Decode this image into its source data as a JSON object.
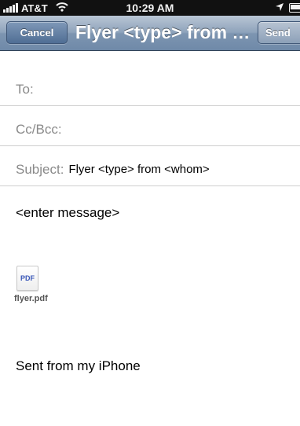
{
  "status_bar": {
    "carrier": "AT&T",
    "time": "10:29 AM",
    "icons": [
      "signal-bars-icon",
      "wifi-icon",
      "location-arrow-icon",
      "battery-icon"
    ]
  },
  "nav": {
    "cancel_label": "Cancel",
    "title": "Flyer <type> from <whom>",
    "send_label": "Send"
  },
  "fields": {
    "to_label": "To:",
    "to_value": "",
    "cc_label": "Cc/Bcc:",
    "cc_value": "",
    "subject_label": "Subject:",
    "subject_value": "Flyer <type> from <whom>"
  },
  "body": {
    "message": "<enter message>",
    "attachment": {
      "icon_text": "PDF",
      "filename": "flyer.pdf"
    },
    "signature": "Sent from my iPhone"
  },
  "colors": {
    "nav_bar": "#8ea3bb",
    "nav_button": "#5a7599",
    "label_gray": "#8a8a8a",
    "divider": "#cfcfcf"
  }
}
